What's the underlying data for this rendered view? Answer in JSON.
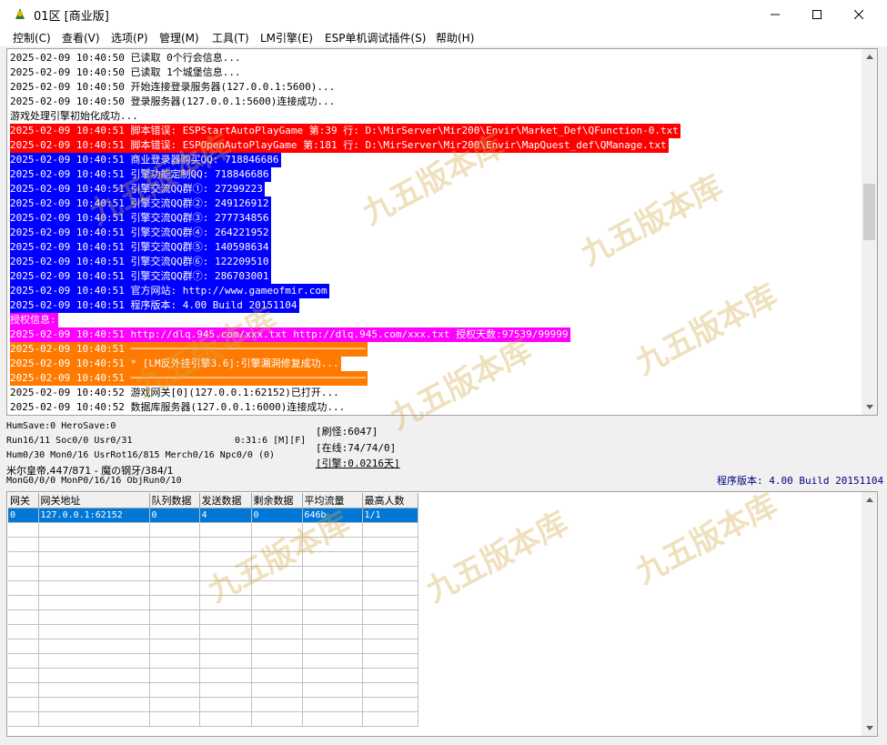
{
  "window": {
    "title": "01区 [商业版]",
    "minimize_glyph": "—",
    "maximize_glyph": "☐",
    "close_glyph": "✕"
  },
  "menu": [
    {
      "label": "控制(C)"
    },
    {
      "label": "查看(V)"
    },
    {
      "label": "选项(P)"
    },
    {
      "label": "管理(M)"
    },
    {
      "label": "工具(T)"
    },
    {
      "label": "LM引擎(E)"
    },
    {
      "label": "ESP单机调试插件(S)"
    },
    {
      "label": "帮助(H)"
    }
  ],
  "log": [
    {
      "text": "2025-02-09 10:40:50 已读取 0个行会信息...",
      "style": "normal"
    },
    {
      "text": "2025-02-09 10:40:50 已读取 1个城堡信息...",
      "style": "normal"
    },
    {
      "text": "2025-02-09 10:40:50 开始连接登录服务器(127.0.0.1:5600)...",
      "style": "normal"
    },
    {
      "text": "2025-02-09 10:40:50 登录服务器(127.0.0.1:5600)连接成功...",
      "style": "normal"
    },
    {
      "text": "游戏处理引擎初始化成功...",
      "style": "normal"
    },
    {
      "text": "2025-02-09 10:40:51 脚本错误: ESPStartAutoPlayGame 第:39 行: D:\\MirServer\\Mir200\\Envir\\Market_Def\\QFunction-0.txt",
      "style": "red"
    },
    {
      "text": "2025-02-09 10:40:51 脚本错误: ESPOpenAutoPlayGame 第:181 行: D:\\MirServer\\Mir200\\Envir\\MapQuest_def\\QManage.txt",
      "style": "red"
    },
    {
      "text": "2025-02-09 10:40:51 商业登录器购买QQ: 718846686",
      "style": "blue"
    },
    {
      "text": "2025-02-09 10:40:51 引擎功能定制QQ: 718846686",
      "style": "blue"
    },
    {
      "text": "2025-02-09 10:40:51 引擎交流QQ群①: 27299223",
      "style": "blue"
    },
    {
      "text": "2025-02-09 10:40:51 引擎交流QQ群②: 249126912",
      "style": "blue"
    },
    {
      "text": "2025-02-09 10:40:51 引擎交流QQ群③: 277734856",
      "style": "blue"
    },
    {
      "text": "2025-02-09 10:40:51 引擎交流QQ群④: 264221952",
      "style": "blue"
    },
    {
      "text": "2025-02-09 10:40:51 引擎交流QQ群⑤: 140598634",
      "style": "blue"
    },
    {
      "text": "2025-02-09 10:40:51 引擎交流QQ群⑥: 122209510",
      "style": "blue"
    },
    {
      "text": "2025-02-09 10:40:51 引擎交流QQ群⑦: 286703001",
      "style": "blue"
    },
    {
      "text": "2025-02-09 10:40:51 官方网站: http://www.gameofmir.com",
      "style": "blue"
    },
    {
      "text": "2025-02-09 10:40:51 程序版本: 4.00 Build 20151104",
      "style": "blue"
    },
    {
      "text": "授权信息:",
      "style": "magenta"
    },
    {
      "text": "2025-02-09 10:40:51 http://dlq.945.com/xxx.txt http://dlq.945.com/xxx.txt 授权天数:97539/99999",
      "style": "magenta"
    },
    {
      "text": "2025-02-09 10:40:51 ───────────────────────────────────────",
      "style": "orange"
    },
    {
      "text": "2025-02-09 10:40:51 * [LM反外挂引擎3.6]:引擎漏洞修复成功...",
      "style": "orange"
    },
    {
      "text": "2025-02-09 10:40:51 ───────────────────────────────────────",
      "style": "orange"
    },
    {
      "text": "2025-02-09 10:40:52 游戏网关[0](127.0.0.1:62152)已打开...",
      "style": "normal"
    },
    {
      "text": "2025-02-09 10:40:52 数据库服务器(127.0.0.1:6000)连接成功...",
      "style": "normal"
    }
  ],
  "status": {
    "line1": "HumSave:0 HeroSave:0",
    "line2": "Run16/11 Soc0/0 Usr0/31",
    "time": "0:31:6 [M][F]",
    "line3": "Hum0/30 Mon0/16 UsrRot16/815 Merch0/16 Npc0/0 (0)",
    "line4": "米尔皇帝,447/871 - 魔の钢牙/384/1",
    "line5": "MonG0/0/0 MonP0/16/16 ObjRun0/10",
    "refresh": "[刷怪:6047]",
    "online": "[在线:74/74/0]",
    "engine": "[引擎:0.0216天]",
    "version": "程序版本: 4.00 Build 20151104"
  },
  "grid": {
    "headers": [
      "网关",
      "网关地址",
      "队列数据",
      "发送数据",
      "剩余数据",
      "平均流量",
      "最高人数"
    ],
    "rows": [
      [
        "0",
        "127.0.0.1:62152",
        "0",
        "4",
        "0",
        "646b",
        "1/1"
      ]
    ]
  },
  "watermark_text": "九五版本库",
  "colors": {
    "error_red": "#ff0000",
    "info_blue": "#0000ff",
    "license_magenta": "#ff00ff",
    "notice_orange": "#ff7a00",
    "selection_blue": "#0078d7",
    "version_text": "#000080"
  }
}
